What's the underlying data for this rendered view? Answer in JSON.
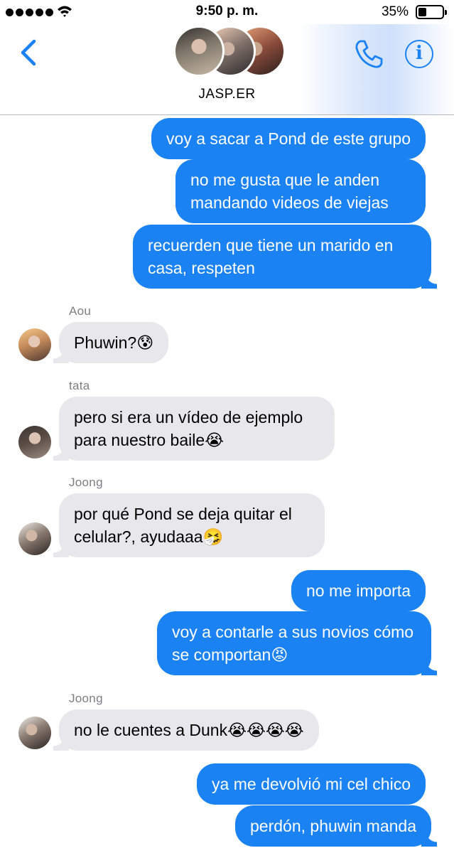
{
  "status_bar": {
    "time": "9:50 p. m.",
    "battery_percent": "35%",
    "battery_level": 0.35,
    "signal_bars": 5,
    "wifi_icon": "wifi-icon"
  },
  "header": {
    "group_name": "JASP.ER",
    "back_icon": "chevron-left-icon",
    "call_icon": "phone-icon",
    "info_icon": "info-icon",
    "info_glyph": "i",
    "accent_color": "#1a82f3"
  },
  "messages": [
    {
      "direction": "out",
      "text": "voy a sacar a Pond de este grupo"
    },
    {
      "direction": "out",
      "text": "no me gusta que le anden mandando videos de viejas"
    },
    {
      "direction": "out",
      "text": "recuerden que tiene un marido en casa, respeten"
    },
    {
      "direction": "in",
      "sender": "Aou",
      "text": "Phuwin?😰"
    },
    {
      "direction": "in",
      "sender": "tata",
      "text": "pero si era un vídeo de ejemplo para nuestro baile😭"
    },
    {
      "direction": "in",
      "sender": "Joong",
      "text": "por qué Pond se deja quitar el celular?, ayudaaa🤧"
    },
    {
      "direction": "out",
      "text": "no me importa"
    },
    {
      "direction": "out",
      "text": "voy a contarle a sus novios cómo se comportan😡"
    },
    {
      "direction": "in",
      "sender": "Joong",
      "text": "no le cuentes a Dunk😭😭😭😭"
    },
    {
      "direction": "out",
      "text": "ya me devolvió mi cel chico"
    },
    {
      "direction": "out",
      "text": "perdón, phuwin manda"
    }
  ],
  "colors": {
    "outgoing_bubble": "#1a82f3",
    "incoming_bubble": "#e7e7ec",
    "sender_name": "#7e7e83"
  }
}
